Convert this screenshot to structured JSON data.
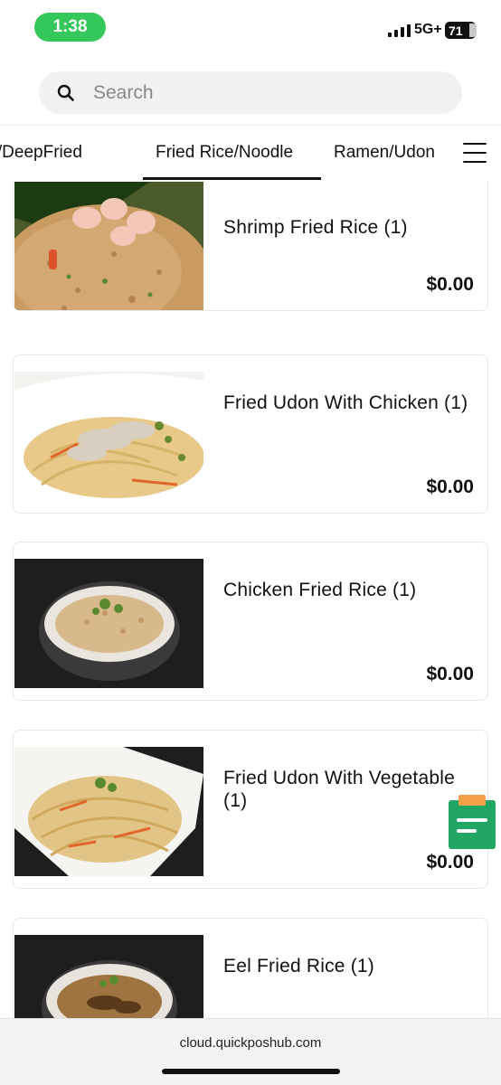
{
  "status_bar": {
    "time": "1:38",
    "network": "5G+",
    "battery": "71"
  },
  "search": {
    "placeholder": "Search"
  },
  "tabs": [
    {
      "label": "Tempura/DeepFried",
      "visible_label": "ra/DeepFried",
      "selected": false
    },
    {
      "label": "Fried Rice/Noodle",
      "visible_label": "Fried Rice/Noodle",
      "selected": true
    },
    {
      "label": "Ramen/Udon",
      "visible_label": "Ramen/Udon",
      "selected": false
    }
  ],
  "menu_items": [
    {
      "name": "Shrimp Fried Rice (1)",
      "price": "$0.00",
      "image": "shrimp-fried-rice"
    },
    {
      "name": "Fried Udon With Chicken (1)",
      "price": "$0.00",
      "image": "fried-udon-chicken"
    },
    {
      "name": "Chicken Fried Rice (1)",
      "price": "$0.00",
      "image": "chicken-fried-rice"
    },
    {
      "name": "Fried Udon With Vegetable (1)",
      "price": "$0.00",
      "image": "fried-udon-vegetable"
    },
    {
      "name": "Eel Fried Rice (1)",
      "price": "",
      "image": "eel-fried-rice"
    }
  ],
  "browser": {
    "url": "cloud.quickposhub.com"
  },
  "colors": {
    "accent_green": "#34c759",
    "fab_green": "#21a663",
    "fab_orange": "#f5a04a"
  }
}
